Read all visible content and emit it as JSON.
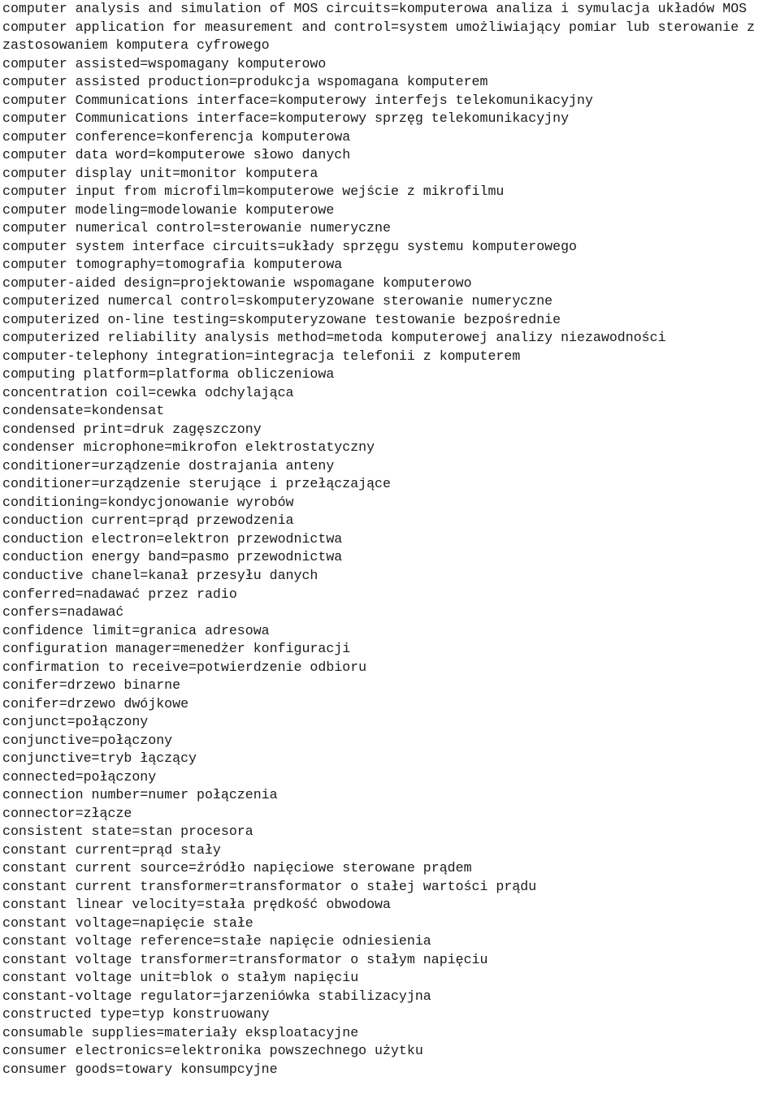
{
  "document": {
    "kind": "plain-text-page",
    "language_pair": "English=Polish",
    "page_background_color": "#ffffff",
    "text_color": "#1a1a1a",
    "entries": [
      "computer analysis and simulation of MOS circuits=komputerowa analiza i symulacja układów MOS",
      "computer application for measurement and control=system umożliwiający pomiar lub sterowanie z zastosowaniem komputera cyfrowego",
      "computer assisted=wspomagany komputerowo",
      "computer assisted production=produkcja wspomagana komputerem",
      "computer Communications interface=komputerowy interfejs telekomunikacyjny",
      "computer Communications interface=komputerowy sprzęg telekomunikacyjny",
      "computer conference=konferencja komputerowa",
      "computer data word=komputerowe słowo danych",
      "computer display unit=monitor komputera",
      "computer input from microfilm=komputerowe wejście z mikrofilmu",
      "computer modeling=modelowanie komputerowe",
      "computer numerical control=sterowanie numeryczne",
      "computer system interface circuits=układy sprzęgu systemu komputerowego",
      "computer tomography=tomografia komputerowa",
      "computer-aided design=projektowanie wspomagane komputerowo",
      "computerized numercal control=skomputeryzowane sterowanie numeryczne",
      "computerized on-line testing=skomputeryzowane testowanie bezpośrednie",
      "computerized reliability analysis method=metoda komputerowej analizy niezawodności",
      "computer-telephony integration=integracja telefonii z komputerem",
      "computing platform=platforma obliczeniowa",
      "concentration coil=cewka odchylająca",
      "condensate=kondensat",
      "condensed print=druk zagęszczony",
      "condenser microphone=mikrofon elektrostatyczny",
      "conditioner=urządzenie dostrajania anteny",
      "conditioner=urządzenie sterujące i przełączające",
      "conditioning=kondycjonowanie wyrobów",
      "conduction current=prąd przewodzenia",
      "conduction electron=elektron przewodnictwa",
      "conduction energy band=pasmo przewodnictwa",
      "conductive chanel=kanał przesyłu danych",
      "conferred=nadawać przez radio",
      "confers=nadawać",
      "confidence limit=granica adresowa",
      "configuration manager=menedżer konfiguracji",
      "confirmation to receive=potwierdzenie odbioru",
      "conifer=drzewo binarne",
      "conifer=drzewo dwójkowe",
      "conjunct=połączony",
      "conjunctive=połączony",
      "conjunctive=tryb łączący",
      "connected=połączony",
      "connection number=numer połączenia",
      "connector=złącze",
      "consistent state=stan procesora",
      "constant current=prąd stały",
      "constant current source=źródło napięciowe sterowane prądem",
      "constant current transformer=transformator o stałej wartości prądu",
      "constant linear velocity=stała prędkość obwodowa",
      "constant voltage=napięcie stałe",
      "constant voltage reference=stałe napięcie odniesienia",
      "constant voltage transformer=transformator o stałym napięciu",
      "constant voltage unit=blok o stałym napięciu",
      "constant-voltage regulator=jarzeniówka stabilizacyjna",
      "constructed type=typ konstruowany",
      "consumable supplies=materiały eksploatacyjne",
      "consumer electronics=elektronika powszechnego użytku",
      "consumer goods=towary konsumpcyjne"
    ]
  }
}
